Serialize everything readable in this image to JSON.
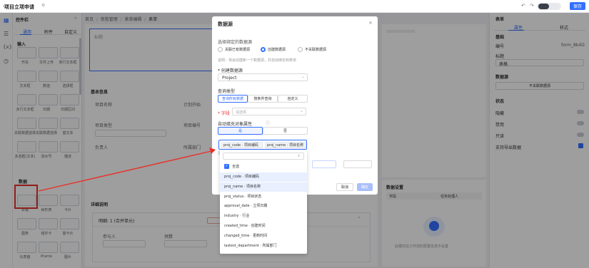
{
  "app": {
    "title": "项目立项申请",
    "back_icon": "back-arrow-icon",
    "save_label": "保存"
  },
  "left": {
    "title": "控件栏",
    "tabs": [
      "通用",
      "附件",
      "自定义"
    ],
    "active_tab": "通用",
    "group_input": "输入",
    "group_data": "数据",
    "widgets": [
      [
        "开关",
        "文件上传",
        "单行文本框"
      ],
      [
        "文本框",
        "数值",
        "选择框"
      ],
      [
        "多行文本框",
        "日期",
        "日期区间"
      ],
      [
        "关联数据选择框-下拉",
        "关联数据选择框-卡片",
        "富文本"
      ],
      [
        "多选框(文本)",
        "流水号",
        "描述"
      ],
      [
        "表格",
        "树形表",
        "卡片"
      ],
      [
        "图表",
        "组件卡",
        "富卡片"
      ],
      [
        "仪表盘",
        "iframe",
        "图片"
      ]
    ]
  },
  "crumbs": [
    "首页",
    "审批管理",
    "表单编辑",
    "表单"
  ],
  "canvas": {
    "title_placeholder": "标题",
    "section_basic": "基本信息",
    "section_detail": "详细说明",
    "fields": [
      "项目名称",
      "项目类型",
      "负责人",
      "计划开始",
      "项目编号",
      "所属部门",
      "参与人",
      "预算"
    ],
    "sub_form": "明细: 1 (合并单元)",
    "pagination": "共 0 条"
  },
  "right": {
    "title": "表单",
    "tabs": [
      "属性",
      "样式"
    ],
    "section_basic": "基础",
    "id_label": "编号",
    "id_value": "form_8k4D",
    "title_label": "标题",
    "title_value": "表格",
    "section_source": "数据源",
    "source_btn": "不关联数据源",
    "section_status": "状态",
    "toggles": [
      "隐藏",
      "禁用",
      "只读",
      "支持导出数据"
    ],
    "empty_text": "此模块在工作流的配置信息中设置",
    "panel_title": "数据设置",
    "panel_col1": "字段",
    "panel_col2": "任务处理人"
  },
  "modal": {
    "title": "数据源",
    "choose_label": "选择绑定的数据源",
    "radios": [
      "关联已有数据源",
      "创建数据源",
      "不关联数据源"
    ],
    "selected_radio": "创建数据源",
    "hint": "说明：将会创建新一个数据源，并自动绑定到表单",
    "create_label": "* 创建数据源",
    "create_value": "Project",
    "method_label": "查询类型",
    "methods": [
      "查询所有数据",
      "按条件查询",
      "自定义"
    ],
    "active_method": "查询所有数据",
    "field_label": "* 字段",
    "field_placeholder": "请选择",
    "auto_label": "自动填充对象属性",
    "toggle_options": [
      "是",
      "否"
    ],
    "active_toggle": "是",
    "cancel_label": "取消",
    "ok_label": "确定",
    "cut_labels": [
      "显示",
      "设置",
      "过滤"
    ]
  },
  "dropdown": {
    "tags": [
      "proj_code · 项目编码",
      "proj_name · 项目名称"
    ],
    "search_placeholder": "",
    "select_all": "全选",
    "options": [
      "proj_code · 项目编码",
      "proj_name · 项目名称",
      "proj_status · 项目状态",
      "approval_date · 立项日期",
      "industry · 行业",
      "created_time · 创建时间",
      "changed_time · 更新时间",
      "lastest_department · 所属部门"
    ],
    "selected_count": 2
  },
  "colors": {
    "primary": "#3370ff",
    "annotation": "#e8312a",
    "option_bg": "#e8efff"
  }
}
